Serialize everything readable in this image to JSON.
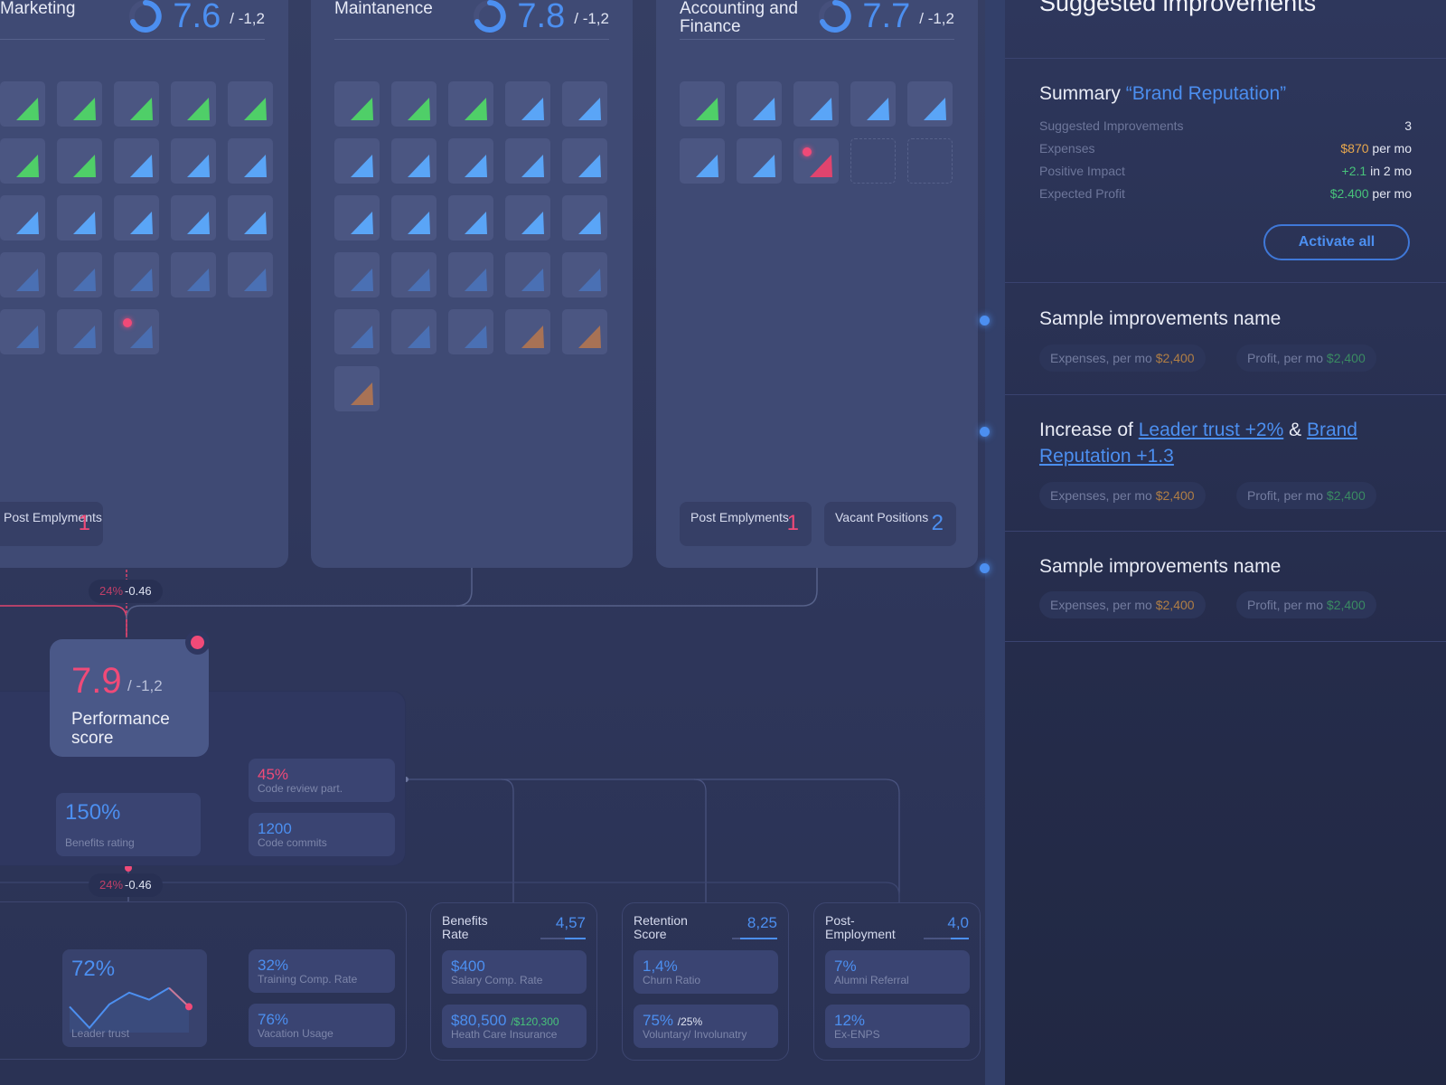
{
  "departments": [
    {
      "name": "Marketing",
      "score": "7.6",
      "delta": "/ -1,2",
      "tiles": [
        "green",
        "green",
        "green",
        "green",
        "green",
        "green",
        "green",
        "blue",
        "blue",
        "blue",
        "blue",
        "blue",
        "blue",
        "blue",
        "blue",
        "blue-dim",
        "blue-dim",
        "blue-dim",
        "blue-dim",
        "blue-dim",
        "blue-dim",
        "blue-dim",
        "blue-dim-alert"
      ],
      "stats": [
        {
          "label": "Post Emplyments",
          "value": "1",
          "tone": "red"
        }
      ]
    },
    {
      "name": "Maintanence",
      "score": "7.8",
      "delta": "/ -1,2",
      "tiles": [
        "green",
        "green",
        "green",
        "blue",
        "blue",
        "blue",
        "blue",
        "blue",
        "blue",
        "blue",
        "blue",
        "blue",
        "blue",
        "blue",
        "blue",
        "blue-dim",
        "blue-dim",
        "blue-dim",
        "blue-dim",
        "blue-dim",
        "blue-dim",
        "blue-dim",
        "blue-dim",
        "orange",
        "orange",
        "orange"
      ],
      "stats": []
    },
    {
      "name": "Accounting and Finance",
      "score": "7.7",
      "delta": "/ -1,2",
      "tiles": [
        "green",
        "blue",
        "blue",
        "blue",
        "blue",
        "blue",
        "blue",
        "red-alert",
        "empty",
        "empty"
      ],
      "stats": [
        {
          "label": "Post Emplyments",
          "value": "1",
          "tone": "red"
        },
        {
          "label": "Vacant Positions",
          "value": "2",
          "tone": "blue"
        }
      ]
    }
  ],
  "connectors": {
    "top": {
      "pct": "24%",
      "delta": "-0.46"
    },
    "bottom": {
      "pct": "24%",
      "delta": "-0.46"
    }
  },
  "performance": {
    "value": "7.9",
    "delta": "/ -1,2",
    "label": "Performance score"
  },
  "metrics": {
    "benefits_rating": {
      "value": "150%",
      "label": "Benefits rating"
    },
    "code_review": {
      "value": "45%",
      "label": "Code review part."
    },
    "code_commits": {
      "value": "1200",
      "label": "Code commits"
    },
    "leader_trust": {
      "value": "72%",
      "label": "Leader trust",
      "trend": [
        0.55,
        0.1,
        0.6,
        0.85,
        0.7,
        0.95,
        0.55
      ]
    },
    "training_comp": {
      "value": "32%",
      "label": "Training Comp. Rate"
    },
    "vacation_usage": {
      "value": "76%",
      "label": "Vacation Usage"
    }
  },
  "score_boxes": [
    {
      "title": "Benefits Rate",
      "score": "4,57",
      "fill": 0.457,
      "items": [
        {
          "value": "$400",
          "suffix": "",
          "label": "Salary Comp. Rate"
        },
        {
          "value": "$80,500",
          "suffix": "/$120,300",
          "label": "Heath Care Insurance"
        }
      ]
    },
    {
      "title": "Retention Score",
      "score": "8,25",
      "fill": 0.825,
      "items": [
        {
          "value": "1,4%",
          "suffix": "",
          "label": "Churn Ratio"
        },
        {
          "value": "75%",
          "suffix": "/25%",
          "label": "Voluntary/ Involunatry"
        }
      ]
    },
    {
      "title": "Post-Employment",
      "score": "4,0",
      "fill": 0.4,
      "items": [
        {
          "value": "7%",
          "suffix": "",
          "label": "Alumni Referral"
        },
        {
          "value": "12%",
          "suffix": "",
          "label": "Ex-ENPS"
        }
      ]
    }
  ],
  "panel": {
    "title": "Suggested improvements",
    "summary_label": "Summary",
    "summary_subject": "“Brand Reputation”",
    "rows": [
      {
        "label": "Suggested Improvements",
        "value": "3",
        "highlight": "",
        "tone": ""
      },
      {
        "label": "Expenses",
        "value": " per mo",
        "highlight": "$870",
        "tone": "orange"
      },
      {
        "label": "Positive Impact",
        "value": " in 2 mo",
        "highlight": "+2.1",
        "tone": "green"
      },
      {
        "label": "Expected Profit",
        "value": " per mo",
        "highlight": "$2.400",
        "tone": "green"
      }
    ],
    "activate_label": "Activate all",
    "improvements": [
      {
        "title": "Sample improvements name",
        "expenses_label": "Expenses, per mo",
        "expenses": "$2,400",
        "profit_label": "Profit, per mo",
        "profit": "$2,400"
      },
      {
        "title_prefix": "Increase of ",
        "link1": "Leader trust +2%",
        "joiner": " & ",
        "link2": "Brand Reputation +1.3",
        "expenses_label": "Expenses, per mo",
        "expenses": "$2,400",
        "profit_label": "Profit, per mo",
        "profit": "$2,400"
      },
      {
        "title": "Sample improvements name",
        "expenses_label": "Expenses, per mo",
        "expenses": "$2,400",
        "profit_label": "Profit, per mo",
        "profit": "$2,400"
      }
    ]
  },
  "colors": {
    "accent": "#4c8ff0",
    "alert": "#f04a78",
    "positive": "#47c27a",
    "warning": "#e8a84e"
  }
}
